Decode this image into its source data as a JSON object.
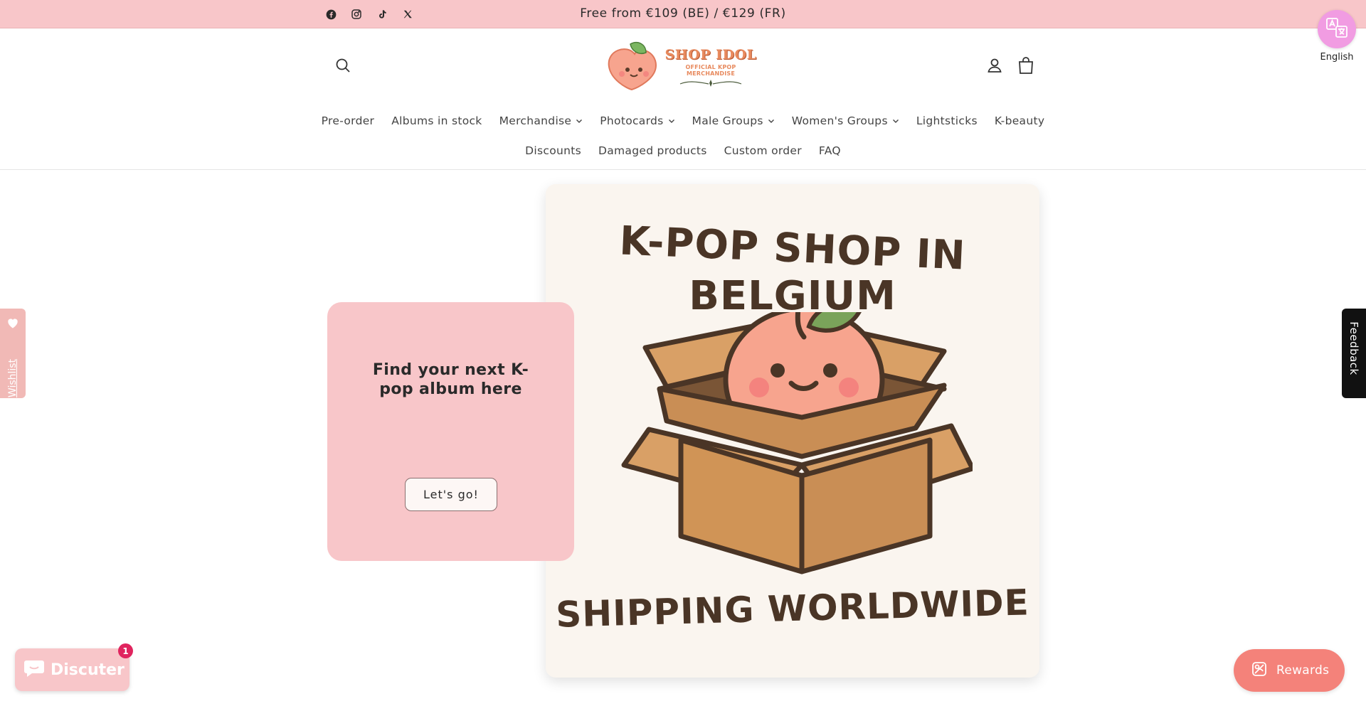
{
  "announcement": {
    "text": "Free from €109 (BE) / €129 (FR)",
    "socials": [
      "facebook-icon",
      "instagram-icon",
      "tiktok-icon",
      "x-icon"
    ]
  },
  "language": {
    "label": "English"
  },
  "logo": {
    "title": "SHOP IDOL",
    "subtitle": "OFFICIAL KPOP MERCHANDISE"
  },
  "nav": {
    "row1": [
      {
        "label": "Pre-order",
        "dropdown": false
      },
      {
        "label": "Albums in stock",
        "dropdown": false
      },
      {
        "label": "Merchandise",
        "dropdown": true
      },
      {
        "label": "Photocards",
        "dropdown": true
      },
      {
        "label": "Male Groups",
        "dropdown": true
      },
      {
        "label": "Women's Groups",
        "dropdown": true
      },
      {
        "label": "Lightsticks",
        "dropdown": false
      },
      {
        "label": "K-beauty",
        "dropdown": false
      }
    ],
    "row2": [
      {
        "label": "Discounts",
        "dropdown": false
      },
      {
        "label": "Damaged products",
        "dropdown": false
      },
      {
        "label": "Custom order",
        "dropdown": false
      },
      {
        "label": "FAQ",
        "dropdown": false
      }
    ]
  },
  "hero": {
    "title": "Find your next K-pop album here",
    "cta": "Let's go!",
    "image_line1": "K-POP SHOP IN",
    "image_line2": "BELGIUM",
    "image_line3": "SHIPPING WORLDWIDE"
  },
  "wishlist": {
    "label": "Wishlist"
  },
  "feedback": {
    "label": "Feedback"
  },
  "chat": {
    "label": "Discuter",
    "badge": "1"
  },
  "rewards": {
    "label": "Rewards"
  },
  "colors": {
    "announcement_bg": "#f8c6c9",
    "hero_card_bg": "#f8c6c9",
    "rewards_bg": "#f4827a",
    "language_bg": "#f19ce2",
    "badge": "#e0245e"
  }
}
